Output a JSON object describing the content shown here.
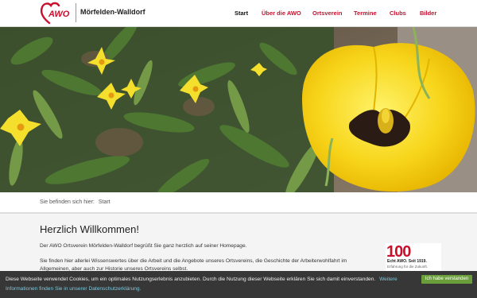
{
  "header": {
    "logo_text": "AWO",
    "site_name": "Mörfelden-Walldorf",
    "brand_color": "#c8102e"
  },
  "nav": {
    "items": [
      {
        "label": "Start",
        "active": true
      },
      {
        "label": "Über die AWO",
        "active": false
      },
      {
        "label": "Ortsverein",
        "active": false
      },
      {
        "label": "Termine",
        "active": false
      },
      {
        "label": "Clubs",
        "active": false
      },
      {
        "label": "Bilder",
        "active": false
      }
    ]
  },
  "breadcrumb": {
    "prefix": "Sie befinden sich hier:",
    "current": "Start"
  },
  "main": {
    "title": "Herzlich Willkommen!",
    "intro": "Der AWO Ortsverein Mörfelden-Walldorf begrüßt Sie ganz herzlich auf seiner Homepage.",
    "body": "Sie finden hier allerlei Wissenswertes über die Arbeit und die Angebote unseres Ortsvereins, die Geschichte der Arbeiterwohlfahrt im Allgemeinen, aber auch zur Historie unseres Ortsvereins selbst."
  },
  "badge": {
    "number": "100",
    "line1": "Echt AWO. Seit 1919.",
    "line2": "Erfahrung für die Zukunft."
  },
  "cookie": {
    "text": "Diese Webseite verwendet Cookies, um ein optimales Nutzungserlebnis anzubieten. Durch die Nutzung dieser Webseite erklären Sie sich damit einverstanden.",
    "link_text": "Weitere Informationen finden Sie in unserer Datenschutzerklärung.",
    "accept_label": "Ich habe verstanden",
    "accept_color": "#6a9e3a"
  }
}
